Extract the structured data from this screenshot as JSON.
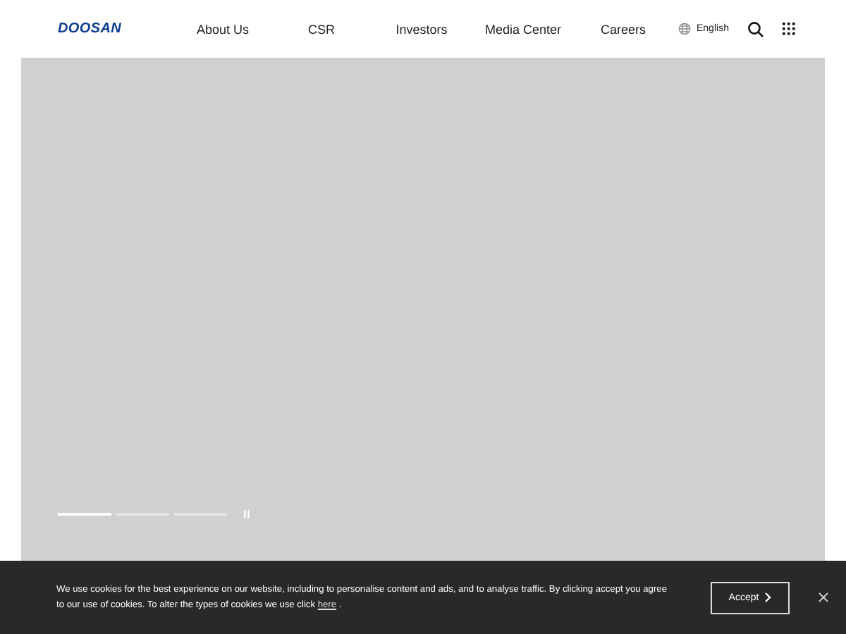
{
  "header": {
    "logo": "DOOSAN",
    "nav": [
      {
        "label": "About Us"
      },
      {
        "label": "CSR"
      },
      {
        "label": "Investors"
      },
      {
        "label": "Media Center"
      },
      {
        "label": "Careers"
      }
    ],
    "language": "English"
  },
  "hero": {
    "slides": [
      {
        "selected": true
      },
      {
        "selected": false
      },
      {
        "selected": false
      }
    ]
  },
  "cookie_banner": {
    "text_before": "We use cookies for the best experience on our website, including to personalise content and ads, and to analyse traffic. By clicking accept you agree to our use of cookies. To alter the types of cookies we use click",
    "link": "here",
    "text_after": ".",
    "accept": "Accept"
  }
}
